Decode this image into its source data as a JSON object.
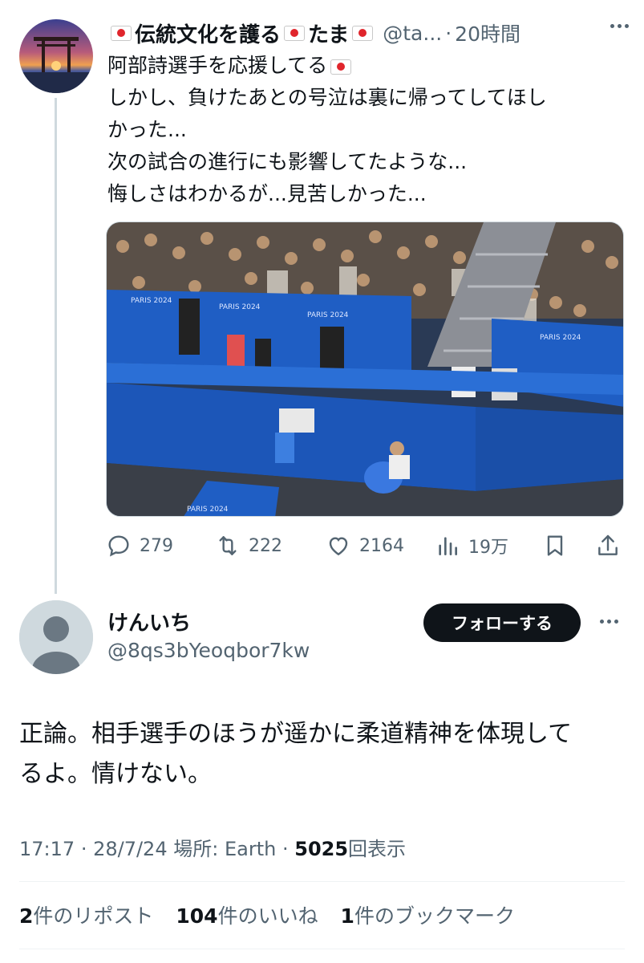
{
  "parent_tweet": {
    "author_name": "伝統文化を護る",
    "author_name_2": "たま",
    "handle": "@ta...",
    "time": "20時間",
    "lines": [
      "阿部詩選手を応援してる",
      "しかし、負けたあとの号泣は裏に帰ってしてほし",
      "かった...",
      "次の試合の進行にも影響してたような...",
      "悔しさはわかるが...見苦しかった..."
    ],
    "media_text": {
      "paris_1": "PARIS 2024",
      "paris_2": "PARIS 2024",
      "paris_3": "PARIS 2024",
      "paris_4": "PARIS 2024",
      "paris_5": "PARIS 2024"
    },
    "actions": {
      "replies": "279",
      "reposts": "222",
      "likes": "2164",
      "views": "19万"
    }
  },
  "reply_tweet": {
    "author_name": "けんいち",
    "handle": "@8qs3bYeoqbor7kw",
    "follow_label": "フォローする",
    "lines": [
      "正論。相手選手のほうが遥かに柔道精神を体現して",
      "るよ。情けない。"
    ],
    "meta": {
      "time": "17:17",
      "date": "28/7/24",
      "location_label": "場所:",
      "location": "Earth",
      "views_count": "5025",
      "views_label": "回表示"
    },
    "stats": {
      "reposts_count": "2",
      "reposts_label": "件のリポスト",
      "likes_count": "104",
      "likes_label": "件のいいね",
      "bookmarks_count": "1",
      "bookmarks_label": "件のブックマーク"
    }
  },
  "colors": {
    "text": "#0f1419",
    "secondary": "#536471",
    "divider": "#eff3f4",
    "arena_blue": "#1f5ec4",
    "flag_red": "#e0252c"
  }
}
